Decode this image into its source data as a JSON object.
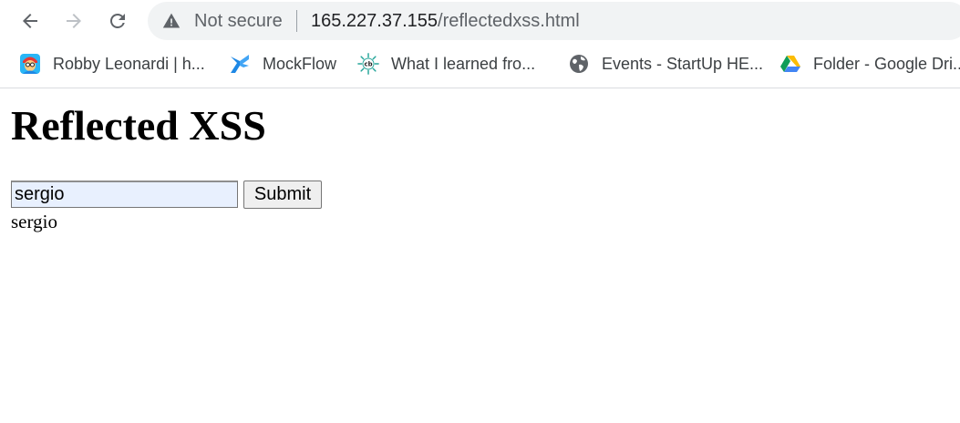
{
  "browser": {
    "security_label": "Not secure",
    "url_host": "165.227.37.155",
    "url_path": "/reflectedxss.html",
    "icons": {
      "back": "arrow-left-icon",
      "forward": "arrow-right-icon",
      "reload": "reload-icon",
      "security": "warning-triangle-icon"
    }
  },
  "bookmarks": [
    {
      "label": "Robby Leonardi | h...",
      "icon": "cartoon-avatar-icon"
    },
    {
      "label": "MockFlow",
      "icon": "mockflow-logo-icon"
    },
    {
      "label": "What I learned fro...",
      "icon": "cb-logo-icon"
    },
    {
      "label": "Events - StartUp HE...",
      "icon": "globe-icon"
    },
    {
      "label": "Folder - Google Dri...",
      "icon": "google-drive-icon"
    }
  ],
  "page": {
    "heading": "Reflected XSS",
    "input_value": "sergio",
    "submit_label": "Submit",
    "output_text": "sergio"
  }
}
